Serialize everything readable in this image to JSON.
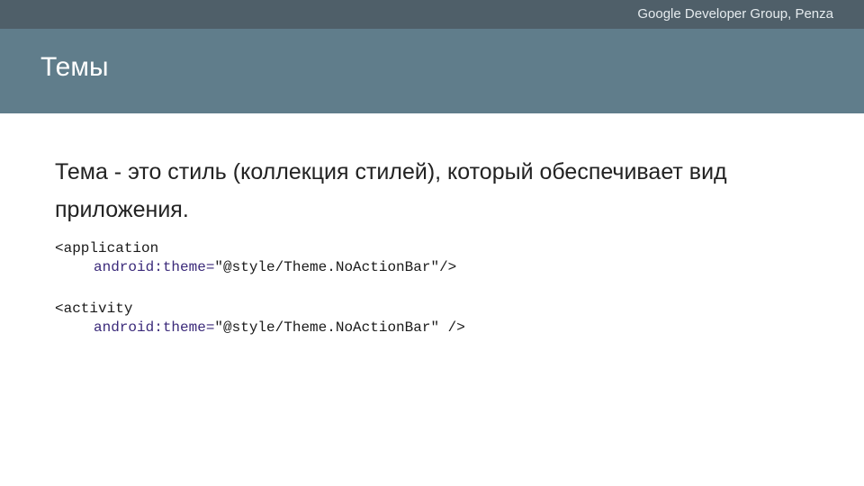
{
  "header": {
    "organization": "Google Developer Group, Penza",
    "title": "Темы"
  },
  "content": {
    "paragraph": "Тема - это стиль (коллекция стилей), который обеспечивает вид приложения.",
    "code_blocks": [
      {
        "tag": "<application",
        "attr": "android:theme=",
        "value": "\"@style/Theme.NoActionBar\"/>"
      },
      {
        "tag": "<activity",
        "attr": "android:theme=",
        "value": "\"@style/Theme.NoActionBar\" />"
      }
    ]
  },
  "colors": {
    "topbar": "#4f5f69",
    "titlebar": "#607d8b",
    "attribute": "#3b2a7a"
  }
}
